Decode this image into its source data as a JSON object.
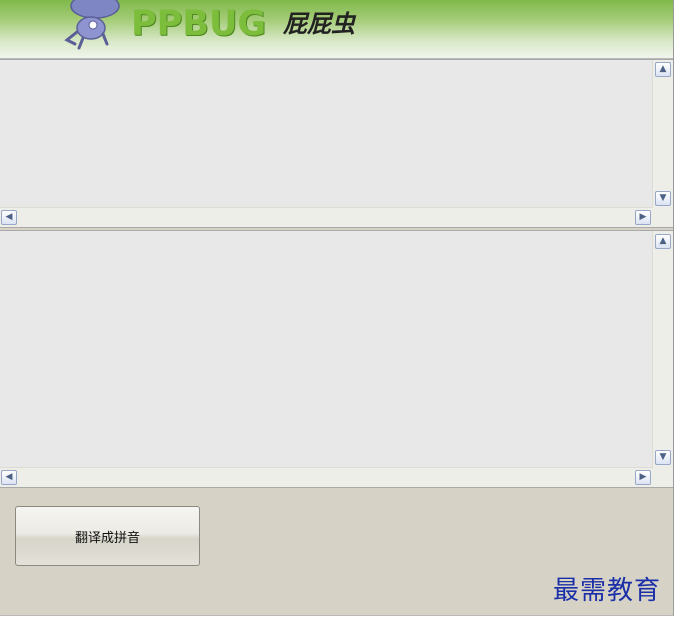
{
  "header": {
    "logo_text": "PPBUG",
    "logo_cn": "屁屁虫"
  },
  "textarea_top": {
    "value": "",
    "scroll_up": "▲",
    "scroll_down": "▼",
    "scroll_left": "◀",
    "scroll_right": "▶"
  },
  "textarea_bottom": {
    "value": "",
    "scroll_up": "▲",
    "scroll_down": "▼",
    "scroll_left": "◀",
    "scroll_right": "▶"
  },
  "actions": {
    "translate_label": "翻译成拼音"
  },
  "watermark": "最需教育",
  "colors": {
    "accent_green": "#7dbd3c",
    "watermark_blue": "#1b2fa8",
    "panel_bg": "#d6d3c6"
  }
}
